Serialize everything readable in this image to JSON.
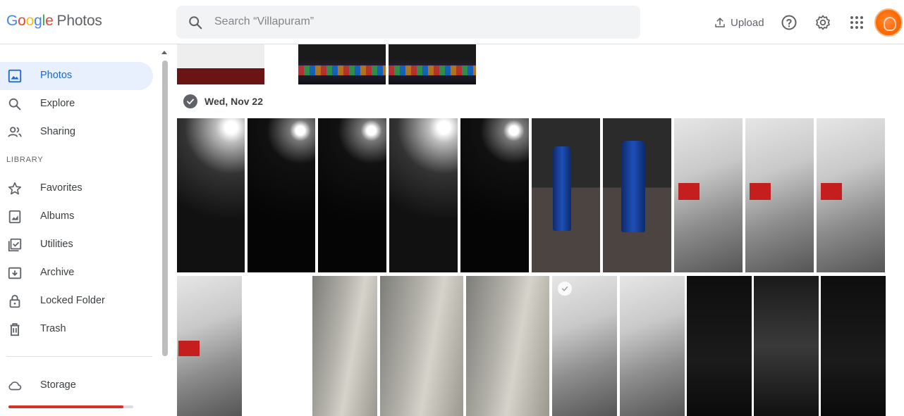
{
  "header": {
    "logo_letters": [
      "G",
      "o",
      "o",
      "g",
      "l",
      "e"
    ],
    "logo_product": "Photos",
    "search_placeholder": "Search “Villapuram”",
    "upload_label": "Upload"
  },
  "sidebar": {
    "items": [
      {
        "label": "Photos",
        "icon": "photo-icon"
      },
      {
        "label": "Explore",
        "icon": "search-icon"
      },
      {
        "label": "Sharing",
        "icon": "people-icon"
      },
      {
        "label": "Favorites",
        "icon": "star-icon"
      },
      {
        "label": "Albums",
        "icon": "album-icon"
      },
      {
        "label": "Utilities",
        "icon": "checklist-icon"
      },
      {
        "label": "Archive",
        "icon": "archive-icon"
      },
      {
        "label": "Locked Folder",
        "icon": "lock-icon"
      },
      {
        "label": "Trash",
        "icon": "trash-icon"
      },
      {
        "label": "Storage",
        "icon": "cloud-icon"
      }
    ],
    "section_library": "LIBRARY",
    "storage_used_fraction": 0.92
  },
  "main": {
    "date_heading": "Wed, Nov 22",
    "colors": {
      "accent": "#1967d2",
      "active_bg": "#e8f0fe",
      "storage_bar": "#d93025"
    }
  }
}
